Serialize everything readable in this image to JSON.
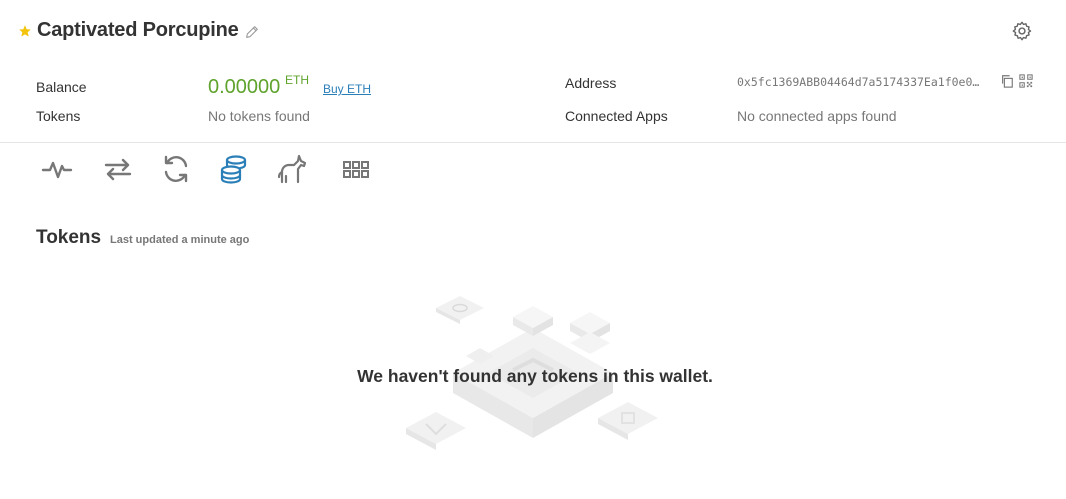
{
  "wallet": {
    "name": "Captivated Porcupine"
  },
  "balance": {
    "label": "Balance",
    "value": "0.00000",
    "unit": "ETH",
    "buy_label": "Buy ETH"
  },
  "tokens_row": {
    "label": "Tokens",
    "value": "No tokens found"
  },
  "address": {
    "label": "Address",
    "value": "0x5fc1369ABB04464d7a5174337Ea1f0e0…"
  },
  "connected_apps": {
    "label": "Connected Apps",
    "value": "No connected apps found"
  },
  "tabs": [
    "activity",
    "transfer",
    "swap",
    "tokens",
    "nfts",
    "apps"
  ],
  "tokens_section": {
    "title": "Tokens",
    "last_updated": "Last updated a minute ago"
  },
  "empty_state": {
    "message": "We haven't found any tokens in this wallet."
  },
  "colors": {
    "accent": "#2b7fb8",
    "balance": "#5fa32d",
    "star": "#f2c40d",
    "icon": "#777777"
  }
}
